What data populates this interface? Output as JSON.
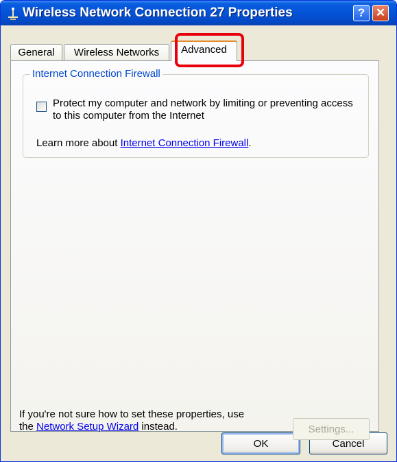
{
  "window": {
    "title": "Wireless Network Connection 27 Properties",
    "icon": "network-connection-icon",
    "help_glyph": "?",
    "close_glyph": "✕"
  },
  "tabs": [
    {
      "label": "General",
      "selected": false
    },
    {
      "label": "Wireless Networks",
      "selected": false
    },
    {
      "label": "Advanced",
      "selected": true
    }
  ],
  "firewall": {
    "group_title": "Internet Connection Firewall",
    "checkbox_label": "Protect my computer and network by limiting or preventing access to this computer from the Internet",
    "checked": false,
    "learn_prefix": "Learn more about ",
    "learn_link": "Internet Connection Firewall",
    "learn_suffix": "."
  },
  "footer": {
    "text_line1": "If you're not sure how to set these properties, use",
    "text_prefix": "the ",
    "wizard_link": "Network Setup Wizard",
    "text_suffix": " instead.",
    "settings_button": "Settings..."
  },
  "buttons": {
    "ok": "OK",
    "cancel": "Cancel"
  },
  "colors": {
    "titlebar": "#0453d6",
    "highlight": "#e8000b",
    "group_title": "#0046d5",
    "link": "#0000ee"
  }
}
